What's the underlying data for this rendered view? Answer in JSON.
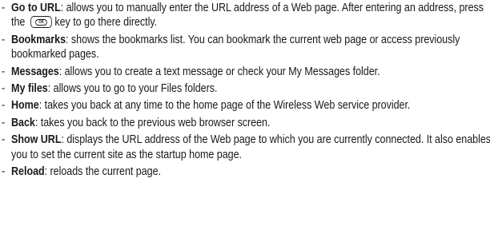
{
  "items": [
    {
      "term": "Go to URL",
      "desc_before_key": ": allows you to manually enter the URL address of a Web page. After entering an address, press the",
      "key_label": "OK",
      "desc_after_key": "key to go there directly."
    },
    {
      "term": "Bookmarks",
      "desc": ": shows the bookmarks list. You can bookmark the current web page or access previously bookmarked pages."
    },
    {
      "term": "Messages",
      "desc": ": allows you to create a text message or check your My Messages folder."
    },
    {
      "term": "My files",
      "desc": ": allows you to go to your Files folders."
    },
    {
      "term": "Home",
      "desc": ": takes you back at any time to the home page of the Wireless Web service provider."
    },
    {
      "term": "Back",
      "desc": ": takes you back to the previous web browser screen."
    },
    {
      "term": "Show URL",
      "desc": ": displays the URL address of the Web page to which you are currently connected. It also enables you to set the current site as the startup home page."
    },
    {
      "term": "Reload",
      "desc": ": reloads the current page."
    }
  ],
  "bullet": "-"
}
